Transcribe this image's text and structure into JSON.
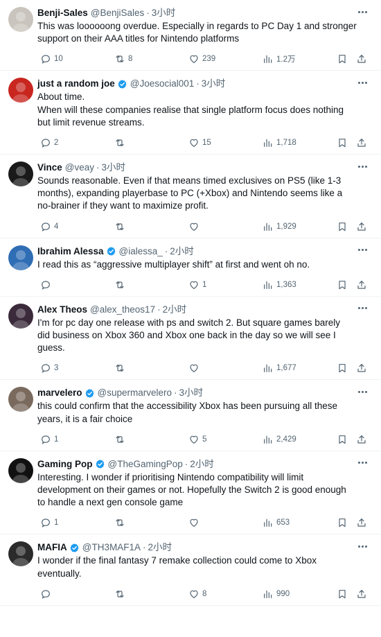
{
  "tweets": [
    {
      "name": "Benji-Sales",
      "verified": false,
      "handle": "@BenjiSales",
      "time": "3小时",
      "lines": [
        "This was loooooong overdue. Especially in regards to PC Day 1 and stronger",
        "support on their AAA titles for Nintendo platforms"
      ],
      "replies": "10",
      "retweets": "8",
      "likes": "239",
      "views": "1.2万",
      "avatar_color": "#c9c4bd"
    },
    {
      "name": "just a random joe",
      "verified": true,
      "handle": "@Joesocial001",
      "time": "3小时",
      "lines": [
        "About time.",
        "When will these companies realise that single platform focus does nothing",
        "but limit revenue streams."
      ],
      "replies": "2",
      "retweets": "",
      "likes": "15",
      "views": "1,718",
      "avatar_color": "#c8261f"
    },
    {
      "name": "Vince",
      "verified": false,
      "handle": "@veay",
      "time": "3小时",
      "lines": [
        "Sounds reasonable. Even if that means timed exclusives on PS5 (like 1-3",
        "months), expanding playerbase to PC (+Xbox) and Nintendo seems like a",
        "no-brainer if they want to maximize profit."
      ],
      "replies": "4",
      "retweets": "",
      "likes": "",
      "views": "1,929",
      "avatar_color": "#1a1a1a"
    },
    {
      "name": "Ibrahim Alessa",
      "verified": true,
      "handle": "@ialessa_",
      "time": "2小时",
      "lines": [
        "I read this as “aggressive multiplayer shift” at first and went oh no."
      ],
      "replies": "",
      "retweets": "",
      "likes": "1",
      "views": "1,363",
      "avatar_color": "#2f6db5"
    },
    {
      "name": "Alex Theos",
      "verified": false,
      "handle": "@alex_theos17",
      "time": "2小时",
      "lines": [
        "I'm for pc day one release with ps and switch 2. But square games barely",
        "did business on Xbox 360 and Xbox one back in the day so we will see I",
        "guess."
      ],
      "replies": "3",
      "retweets": "",
      "likes": "",
      "views": "1,677",
      "avatar_color": "#3a2a3a"
    },
    {
      "name": "marvelero",
      "verified": true,
      "handle": "@supermarvelero",
      "time": "3小时",
      "lines": [
        "this could confirm that the accessibility Xbox has been pursuing all these",
        "years, it is a fair choice"
      ],
      "replies": "1",
      "retweets": "",
      "likes": "5",
      "views": "2,429",
      "avatar_color": "#7a6a5e"
    },
    {
      "name": "Gaming Pop",
      "verified": true,
      "handle": "@TheGamingPop",
      "time": "2小时",
      "lines": [
        "Interesting. I wonder if prioritising Nintendo compatibility will limit",
        "development on their games or not. Hopefully the Switch 2 is good enough",
        "to handle a next gen console game"
      ],
      "replies": "1",
      "retweets": "",
      "likes": "",
      "views": "653",
      "avatar_color": "#111111"
    },
    {
      "name": "MAFIA",
      "verified": true,
      "handle": "@TH3MAF1A",
      "time": "2小时",
      "lines": [
        "I wonder if the final fantasy 7 remake collection could come to Xbox",
        "eventually."
      ],
      "replies": "",
      "retweets": "",
      "likes": "8",
      "views": "990",
      "avatar_color": "#2b2b2b"
    }
  ]
}
